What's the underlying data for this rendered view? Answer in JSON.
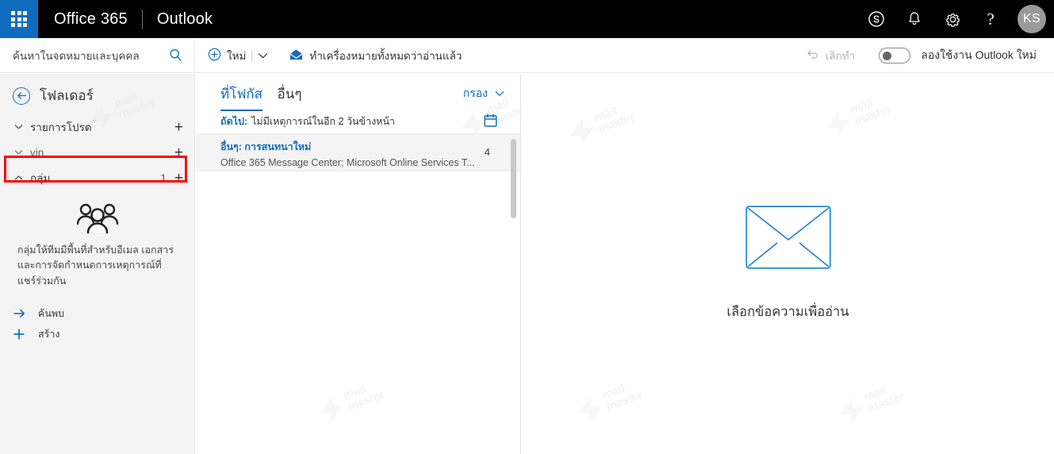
{
  "suitebar": {
    "waffle_name": "app-launcher",
    "brand": "Office 365",
    "app": "Outlook",
    "icons": [
      {
        "name": "skype-icon",
        "label": "Skype"
      },
      {
        "name": "notifications-bell-icon",
        "label": "Notifications"
      },
      {
        "name": "settings-gear-icon",
        "label": "Settings"
      },
      {
        "name": "help-icon",
        "label": "?"
      }
    ],
    "avatar": {
      "initials": "KS",
      "presence": "available",
      "presence_color": "#13a10e"
    }
  },
  "search": {
    "placeholder": "ค้นหาในจดหมายและบุคคล",
    "value": "",
    "icon": "search-icon"
  },
  "commandbar": {
    "new_label": "ใหม่",
    "new_icon": "circle-plus-icon",
    "new_chevron": "chevron-down-icon",
    "mark_all_read_label": "ทำเครื่องหมายทั้งหมดว่าอ่านแล้ว",
    "mark_all_read_icon": "open-envelope-icon",
    "undo_label": "เลิกทำ",
    "undo_icon": "undo-arrow-icon",
    "toggle_label": "ลองใช้งาน Outlook ใหม่",
    "toggle_state": "off"
  },
  "folderpane": {
    "back_icon": "back-arrow-circle-icon",
    "title": "โฟลเดอร์",
    "rows": [
      {
        "name": "favorites",
        "caret": "chevron-down-icon",
        "label": "รายการโปรด",
        "count": "",
        "add": "+",
        "muted": false,
        "highlighted": false
      },
      {
        "name": "vin",
        "caret": "chevron-down-icon",
        "label": "vin",
        "count": "",
        "add": "+",
        "muted": true,
        "highlighted": false
      },
      {
        "name": "groups",
        "caret": "chevron-up-icon",
        "label": "กลุ่ม",
        "count": "1",
        "add": "+",
        "muted": false,
        "highlighted": true
      }
    ],
    "groups_promo": {
      "icon": "people-group-icon",
      "description": "กลุ่มให้ทีมมีพื้นที่สำหรับอีเมล เอกสาร และการจัดกำหนดการเหตุการณ์ที่แชร์ร่วมกัน"
    },
    "actions": [
      {
        "name": "discover",
        "icon": "arrow-right-icon",
        "label": "ค้นพบ"
      },
      {
        "name": "create",
        "icon": "plus-icon",
        "label": "สร้าง"
      }
    ],
    "highlight_color": "#ff0000"
  },
  "messagelist": {
    "pivots": [
      {
        "name": "focused",
        "label": "ที่โฟกัส",
        "active": true
      },
      {
        "name": "other",
        "label": "อื่นๆ",
        "active": false
      }
    ],
    "filter_label": "กรอง",
    "filter_chevron": "chevron-down-icon",
    "next_key": "ถัดไป:",
    "next_value": "ไม่มีเหตุการณ์ในอีก 2 วันข้างหน้า",
    "calendar_icon": "calendar-icon",
    "items": [
      {
        "name": "message-other-new-conversations",
        "subject": "อื่นๆ: การสนทนาใหม่",
        "preview": "Office 365 Message Center; Microsoft Online Services T...",
        "count": "4",
        "selected": true
      }
    ]
  },
  "readingpane": {
    "icon": "envelope-outline-icon",
    "empty_text": "เลือกข้อความเพื่ออ่าน"
  },
  "watermark": {
    "line1": "mail",
    "line2": "master"
  },
  "colors": {
    "accent": "#0f6cbd",
    "suitebar_bg": "#000000",
    "folderpane_bg": "#f4f4f4",
    "highlight": "#ff0000",
    "count_red": "#e81123"
  }
}
